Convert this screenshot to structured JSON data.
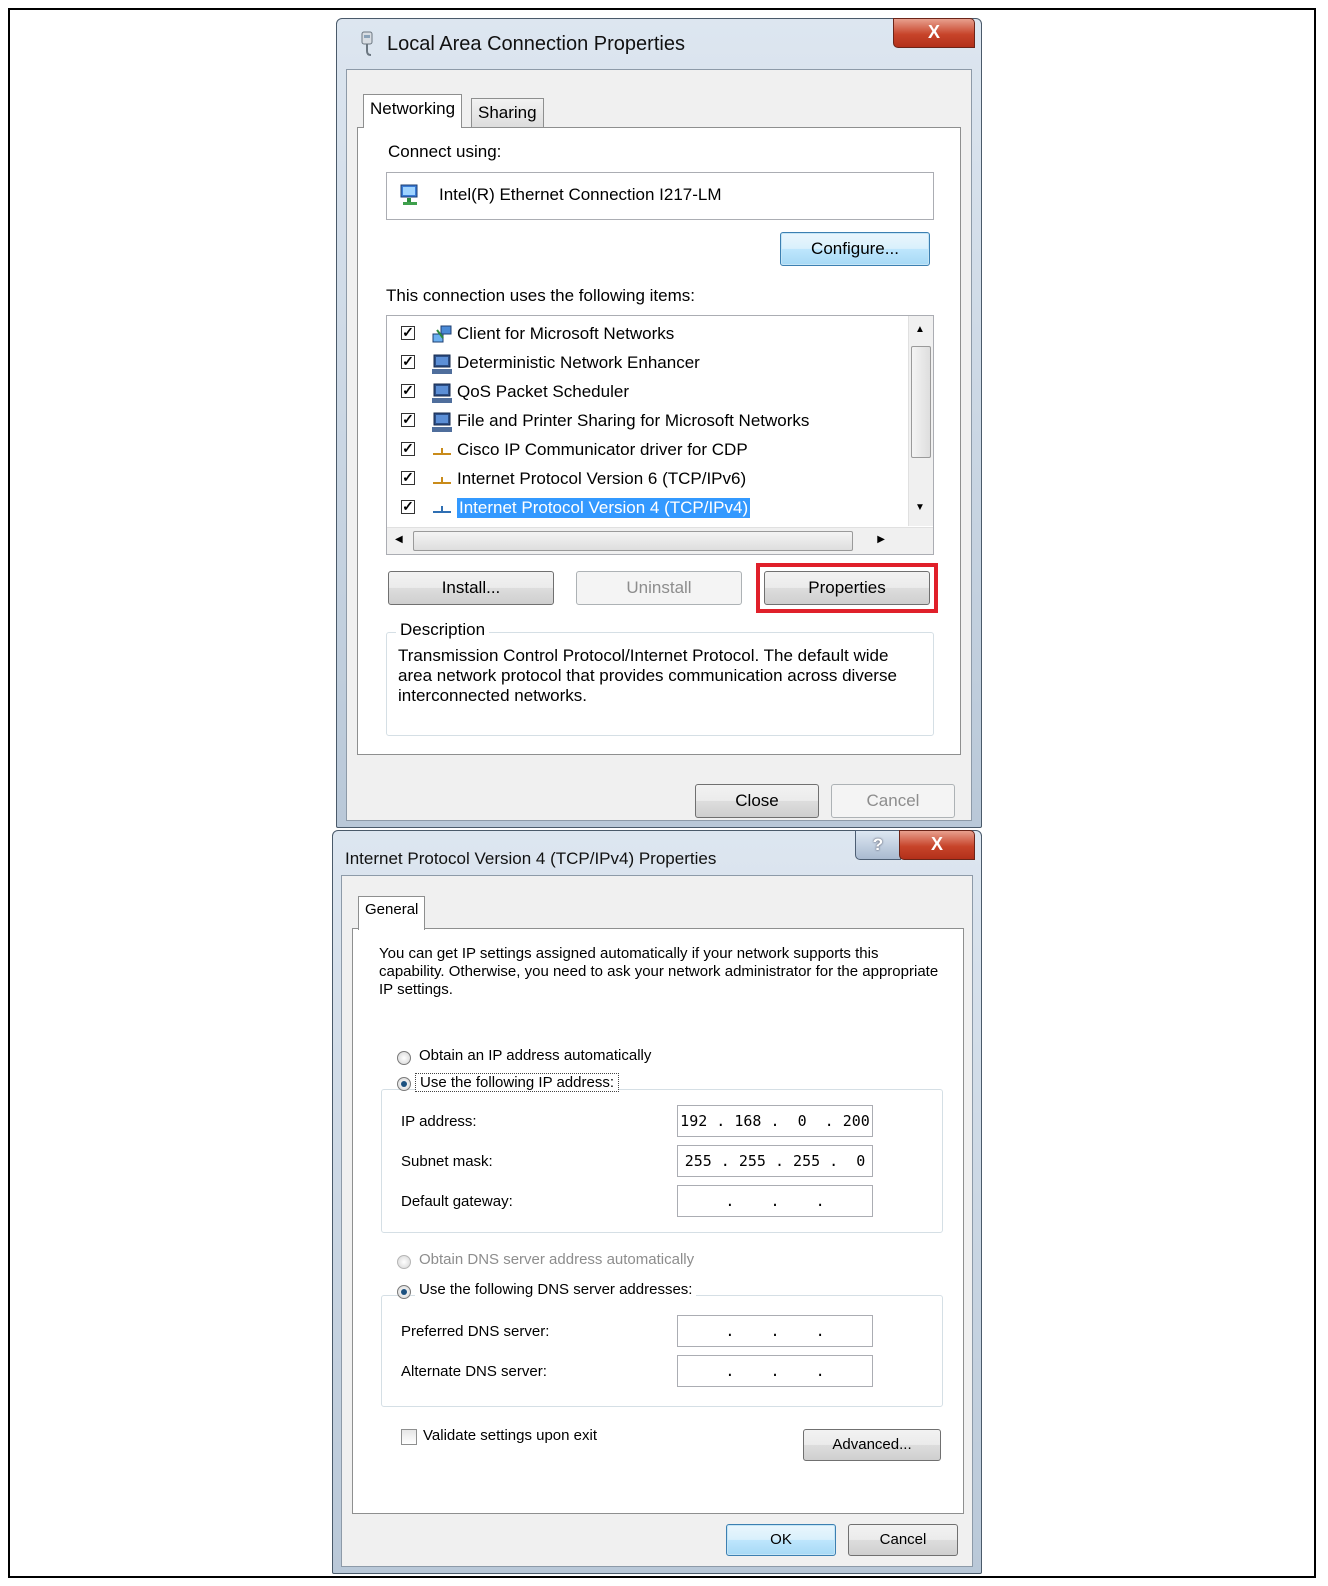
{
  "dialog1": {
    "title": "Local Area Connection Properties",
    "close_glyph": "X",
    "tabs": [
      "Networking",
      "Sharing"
    ],
    "connect_using_label": "Connect using:",
    "adapter": "Intel(R) Ethernet Connection I217-LM",
    "configure_label": "Configure...",
    "items_label": "This connection uses the following items:",
    "items": [
      {
        "label": "Client for Microsoft Networks",
        "checked": true
      },
      {
        "label": "Deterministic Network Enhancer",
        "checked": true
      },
      {
        "label": "QoS Packet Scheduler",
        "checked": true
      },
      {
        "label": "File and Printer Sharing for Microsoft Networks",
        "checked": true
      },
      {
        "label": "Cisco IP Communicator driver for CDP",
        "checked": true
      },
      {
        "label": "Internet Protocol Version 6 (TCP/IPv6)",
        "checked": true
      },
      {
        "label": "Internet Protocol Version 4 (TCP/IPv4)",
        "checked": true,
        "selected": true
      }
    ],
    "install_label": "Install...",
    "uninstall_label": "Uninstall",
    "properties_label": "Properties",
    "description_label": "Description",
    "description_text": "Transmission Control Protocol/Internet Protocol. The default wide area network protocol that provides communication across diverse interconnected networks.",
    "close_label": "Close",
    "cancel_label": "Cancel",
    "highlight_color": "#e0202a"
  },
  "dialog2": {
    "title": "Internet Protocol Version 4 (TCP/IPv4) Properties",
    "help_glyph": "?",
    "close_glyph": "X",
    "tab": "General",
    "intro": "You can get IP settings assigned automatically if your network supports this capability. Otherwise, you need to ask your network administrator for the appropriate IP settings.",
    "obtain_ip_auto": "Obtain an IP address automatically",
    "use_following_ip": "Use the following IP address:",
    "ip_address_label": "IP address:",
    "ip_address_value": "192 . 168 .  0  . 200",
    "subnet_label": "Subnet mask:",
    "subnet_value": "255 . 255 . 255 .  0",
    "gateway_label": "Default gateway:",
    "gateway_value": " .    .    . ",
    "obtain_dns_auto": "Obtain DNS server address automatically",
    "use_following_dns": "Use the following DNS server addresses:",
    "preferred_dns_label": "Preferred DNS server:",
    "preferred_dns_value": " .    .    . ",
    "alternate_dns_label": "Alternate DNS server:",
    "alternate_dns_value": " .    .    . ",
    "validate_label": "Validate settings upon exit",
    "advanced_label": "Advanced...",
    "ok_label": "OK",
    "cancel_label": "Cancel"
  }
}
